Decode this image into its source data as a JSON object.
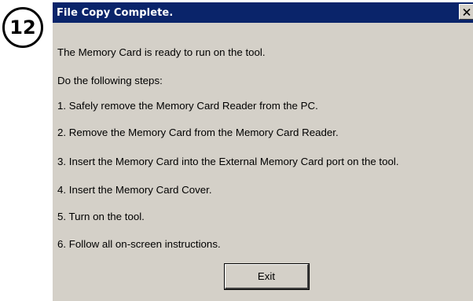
{
  "step_badge": {
    "number": "12"
  },
  "dialog": {
    "title": "File Copy Complete.",
    "close_icon": "close-icon",
    "lines": [
      "The Memory Card is ready to run on the tool.",
      "Do the following steps:",
      "1. Safely remove the Memory Card Reader from the PC.",
      "2. Remove the Memory Card from the  Memory Card Reader.",
      "3. Insert the Memory Card into the External Memory Card port on the tool.",
      "4. Insert the Memory Card Cover.",
      "5. Turn on the tool.",
      "6. Follow all on-screen instructions."
    ],
    "exit_label": "Exit"
  },
  "colors": {
    "titlebar": "#0a246a",
    "dialog_background": "#d4d0c8"
  }
}
